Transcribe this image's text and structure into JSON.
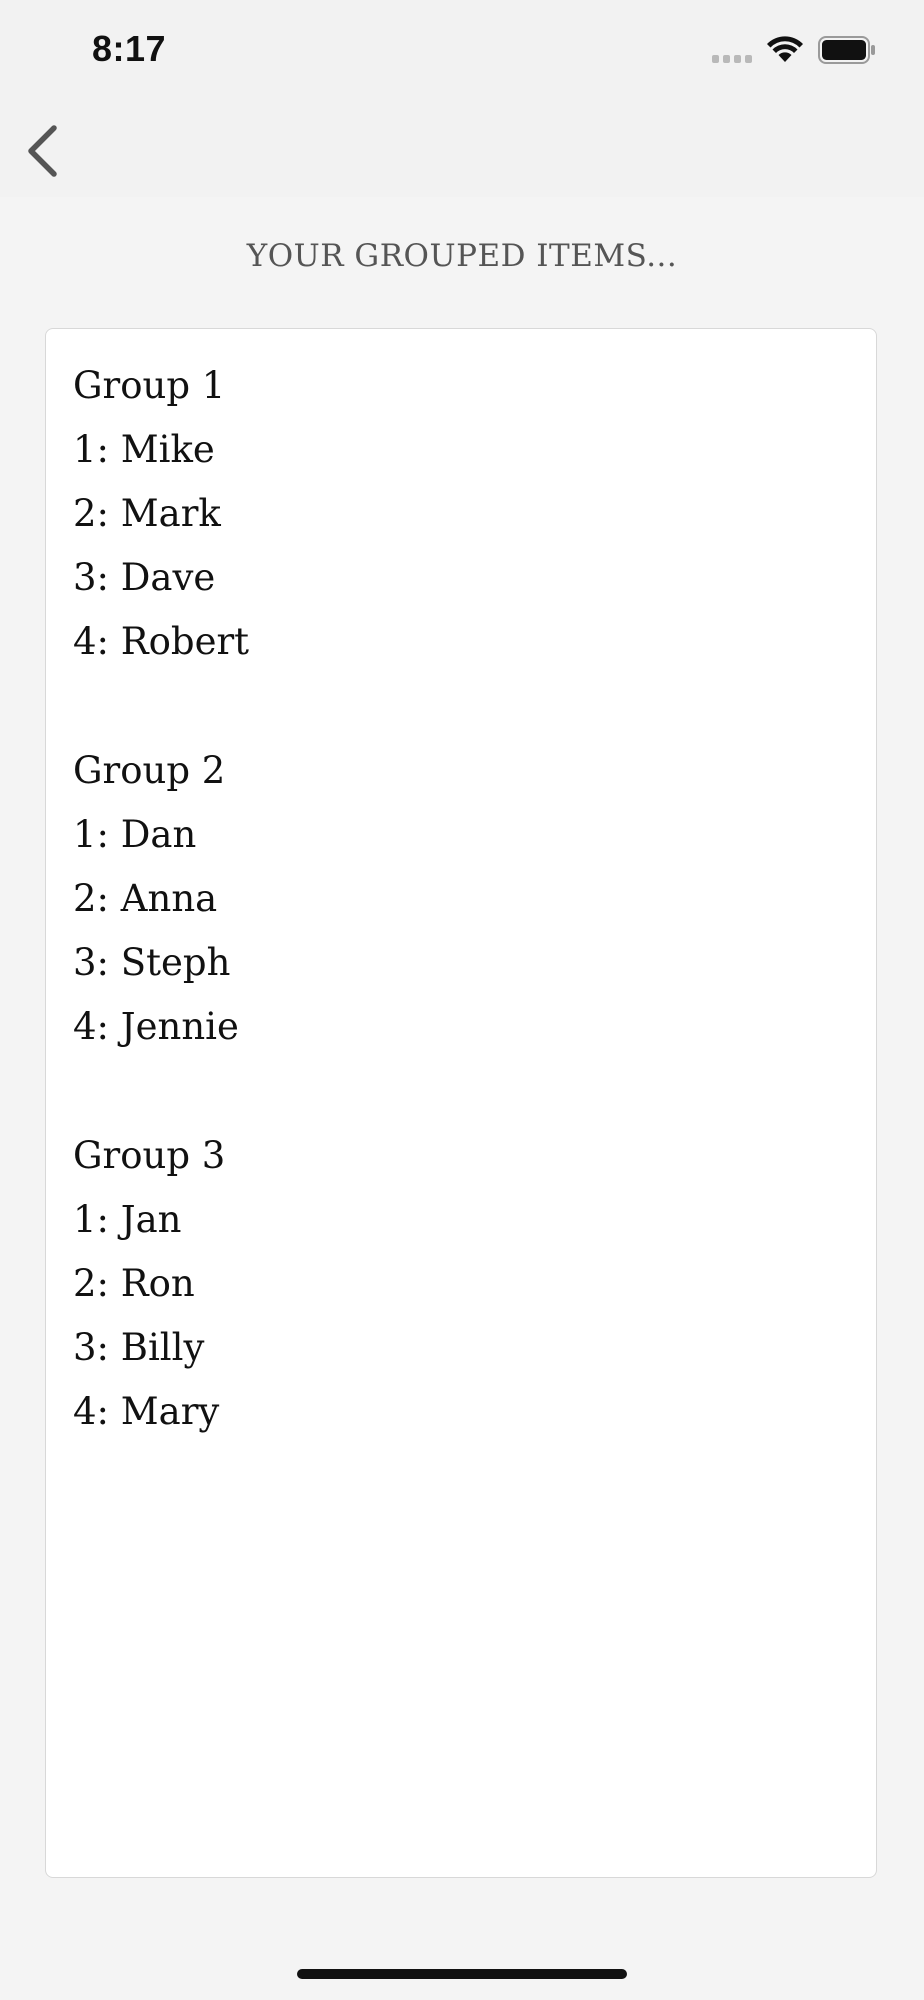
{
  "status_bar": {
    "time": "8:17"
  },
  "nav": {
    "back_icon": "chevron-left-icon"
  },
  "page": {
    "title": "YOUR GROUPED ITEMS..."
  },
  "groups": [
    {
      "title": "Group 1",
      "members": [
        "1: Mike",
        "2: Mark",
        "3: Dave",
        "4: Robert"
      ]
    },
    {
      "title": "Group 2",
      "members": [
        "1: Dan",
        "2: Anna",
        "3: Steph",
        "4: Jennie"
      ]
    },
    {
      "title": "Group 3",
      "members": [
        "1: Jan",
        "2: Ron",
        "3: Billy",
        "4: Mary"
      ]
    }
  ],
  "colors": {
    "background": "#f4f4f4",
    "card": "#ffffff",
    "text": "#111111",
    "title": "#555555"
  }
}
